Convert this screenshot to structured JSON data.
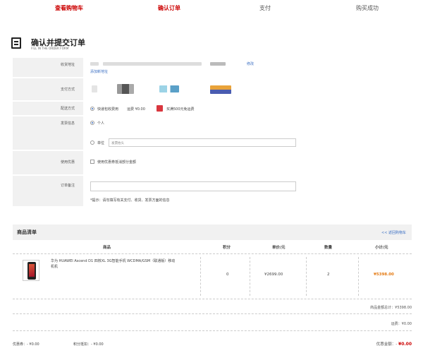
{
  "steps": [
    {
      "label": "查看购物车",
      "active": true
    },
    {
      "label": "确认订单",
      "active": true
    },
    {
      "label": "支付",
      "active": false
    },
    {
      "label": "购买成功",
      "active": false
    }
  ],
  "page": {
    "title": "确认并提交订单",
    "subtitle": "FILL IN THE ORDER FORM"
  },
  "form": {
    "address": {
      "label": "收货地址",
      "edit_link": "修改",
      "add_link": "添加新地址"
    },
    "payment": {
      "label": "支付方式"
    },
    "delivery": {
      "label": "配送方式",
      "option": "快递包收费用",
      "fee": "运费 ¥0.00",
      "promo": "买满500元免运费"
    },
    "invoice": {
      "label": "发票信息",
      "personal": "个人",
      "company": "单位",
      "placeholder": "发票抬头"
    },
    "coupon": {
      "label": "使用优惠",
      "text": "使用优惠券抵消部分金额"
    },
    "remark": {
      "label": "订单备注",
      "hint": "*提示：请勿填写有关支付、收货、发票方面的信息"
    }
  },
  "goods": {
    "title": "商品清单",
    "back_link": "<< 返回购物车",
    "columns": {
      "product": "商品",
      "points": "积分",
      "price": "单价/元",
      "qty": "数量",
      "subtotal": "小计/元"
    },
    "items": [
      {
        "name": "华为 HUAWEI Ascend D1 四核XL 3G智能手机 WCDMA/GSM（联通版）移动机机",
        "points": "0",
        "price": "¥2699.00",
        "qty": "2",
        "subtotal": "¥5398.00"
      }
    ]
  },
  "summary": {
    "goods_total": "商品金额总计：¥5398.00",
    "freight": "运费：¥0.00",
    "coupon_discount": "优惠券：- ¥0.00",
    "points_discount": "积分抵扣：- ¥0.00",
    "final_label": "优惠金额：-",
    "final_value": "¥0.00"
  },
  "colors": {
    "accent": "#cc0000",
    "link": "#3b6fc3",
    "price": "#e47911"
  }
}
